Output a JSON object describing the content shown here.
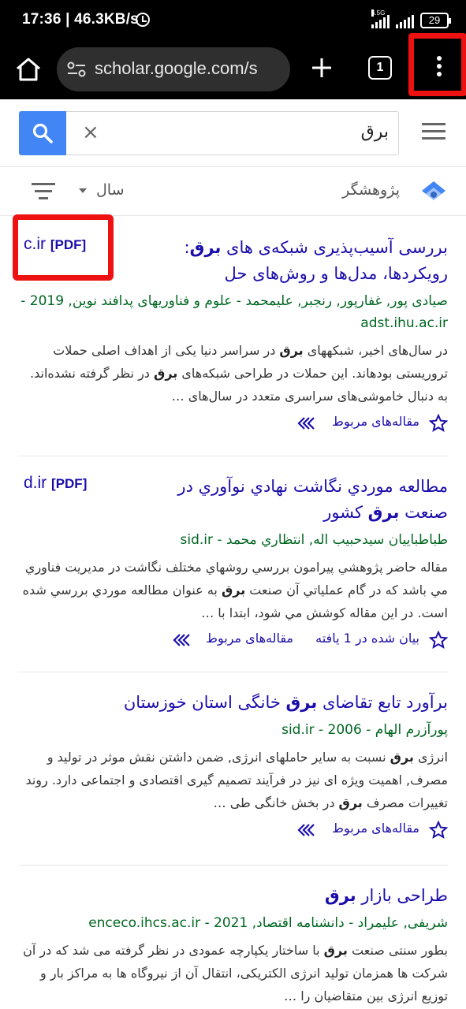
{
  "status_bar": {
    "time_speed": "17:36 | 46.3KB/s",
    "network": "4.5G",
    "battery": "29"
  },
  "browser": {
    "url": "scholar.google.com/s",
    "tab_count": "1"
  },
  "search": {
    "query": "برق",
    "clear_symbol": "×"
  },
  "filters": {
    "year_label": "سال",
    "researcher_label": "پژوهشگر"
  },
  "results": [
    {
      "title_1": "بررسی آسیب‌پذیری شبکه‌ی های ",
      "title_bold": "برق",
      "title_2": ":",
      "title_line2": "رویکردها، مدل‌ها و روش‌های حل",
      "meta_line1": "صیادی پور, غفارپور, رنجبر, علیمحمد - علوم و فناوریهای پدافند نوین, 2019 -",
      "meta_line2": "adst.ihu.ac.ir",
      "pdf_domain": "c.ir",
      "pdf_tag": "[PDF]",
      "snippet_1": "در سال‌های اخیر، شبکههای ",
      "snippet_b1": "برق",
      "snippet_2": " در سراسر دنیا یکی از اهداف اصلی حملات تروریستی بودهاند. این حملات در طراحی شبکه‌های ",
      "snippet_b2": "برق",
      "snippet_3": " در نظر گرفته نشده‌اند. به دنبال خاموشی‌های سراسری متعدد در سال‌های …",
      "related": "مقاله‌های مربوط"
    },
    {
      "title_1": "مطالعه موردي نگاشت نهادي نوآوري در صنعت ",
      "title_bold": "برق",
      "title_2": " كشور",
      "meta_line1": "طباطبايیان سيدحبيب اله, انتظاري محمد - sid.ir",
      "pdf_domain": "d.ir",
      "pdf_tag": "[PDF]",
      "snippet_1": "مقاله حاضر پژوهشي پيرامون بررسي روشهاي مختلف نگاشت در مديريت فناوري مي باشد كه در گام عملياتي آن صنعت ",
      "snippet_b1": "برق",
      "snippet_2": " به عنوان مطالعه موردي بررسي شده است. در اين مقاله كوشش مي شود، ابتدا با …",
      "cited": "بیان شده در 1 یافته",
      "related": "مقاله‌های مربوط"
    },
    {
      "title_1": "برآورد تابع تقاضای ",
      "title_bold": "برق",
      "title_2": " خانگی استان خوزستان",
      "meta_line1": "پورآزرم الهام - 2006 - sid.ir",
      "snippet_b0": "انرژی ",
      "snippet_b1": "برق",
      "snippet_1": " نسبت به سایر حاملهای انرژی, ضمن داشتن نقش موثر در تولید و مصرف, اهمیت ویژه ای نیز در فرآیند تصمیم گیری اقتصادی و اجتماعی دارد. روند تغییرات مصرف ",
      "snippet_b2": "برق",
      "snippet_2": " در بخش خانگی طی …",
      "related": "مقاله‌های مربوط"
    },
    {
      "title_1": "طراحی بازار ",
      "title_bold": "برق",
      "meta_line1": "شریفی, علیمراد - دانشنامه اقتصاد, 2021 - enceco.ihcs.ac.ir",
      "snippet_1": "بطور سنتی صنعت ",
      "snippet_b1": "برق",
      "snippet_2": " با ساختار یکپارچه عمودی در نظر گرفته می شد که در آن شرکت ها همزمان تولید انرژی الکتریکی، انتقال آن از نیروگاه ها به مراکز بار و توزیع انرژی بین متقاضیان را …"
    }
  ]
}
